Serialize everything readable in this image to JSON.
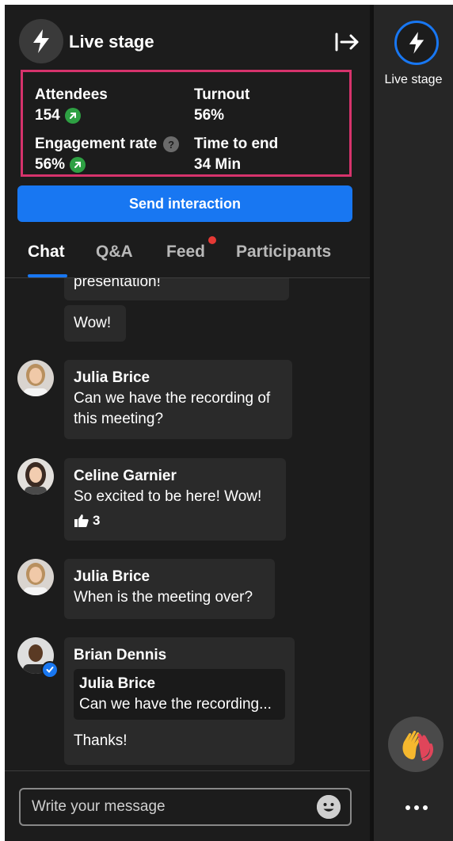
{
  "header": {
    "title": "Live stage",
    "icon": "lightning-icon",
    "exit_icon": "exit-arrow-icon"
  },
  "stats": {
    "attendees_label": "Attendees",
    "attendees_value": "154",
    "turnout_label": "Turnout",
    "turnout_value": "56%",
    "engagement_label": "Engagement rate",
    "engagement_value": "56%",
    "time_label": "Time to end",
    "time_value": "34 Min",
    "highlight_color": "#d6336c",
    "trend_color": "#2ea043"
  },
  "send_button": {
    "label": "Send interaction",
    "color": "#1877f2"
  },
  "tabs": [
    {
      "label": "Chat",
      "active": true
    },
    {
      "label": "Q&A"
    },
    {
      "label": "Feed",
      "has_notification": true
    },
    {
      "label": "Participants"
    }
  ],
  "messages": [
    {
      "text_partial": "presentation!"
    },
    {
      "text": "Wow!"
    },
    {
      "author": "Julia Brice",
      "text": "Can we have the recording of this meeting?"
    },
    {
      "author": "Celine Garnier",
      "text": "So excited to be here! Wow!",
      "likes": "3"
    },
    {
      "author": "Julia Brice",
      "text": "When is the meeting over?"
    },
    {
      "author": "Brian Dennis",
      "verified": true,
      "quote": {
        "author": "Julia Brice",
        "text": "Can we have the recording..."
      },
      "text": "Thanks!"
    }
  ],
  "composer": {
    "placeholder": "Write your message",
    "emoji_icon": "smiley-icon"
  },
  "rail": {
    "live_stage_label": "Live stage",
    "clap_icon": "clapping-hands-icon",
    "more_icon": "more-dots-icon"
  }
}
